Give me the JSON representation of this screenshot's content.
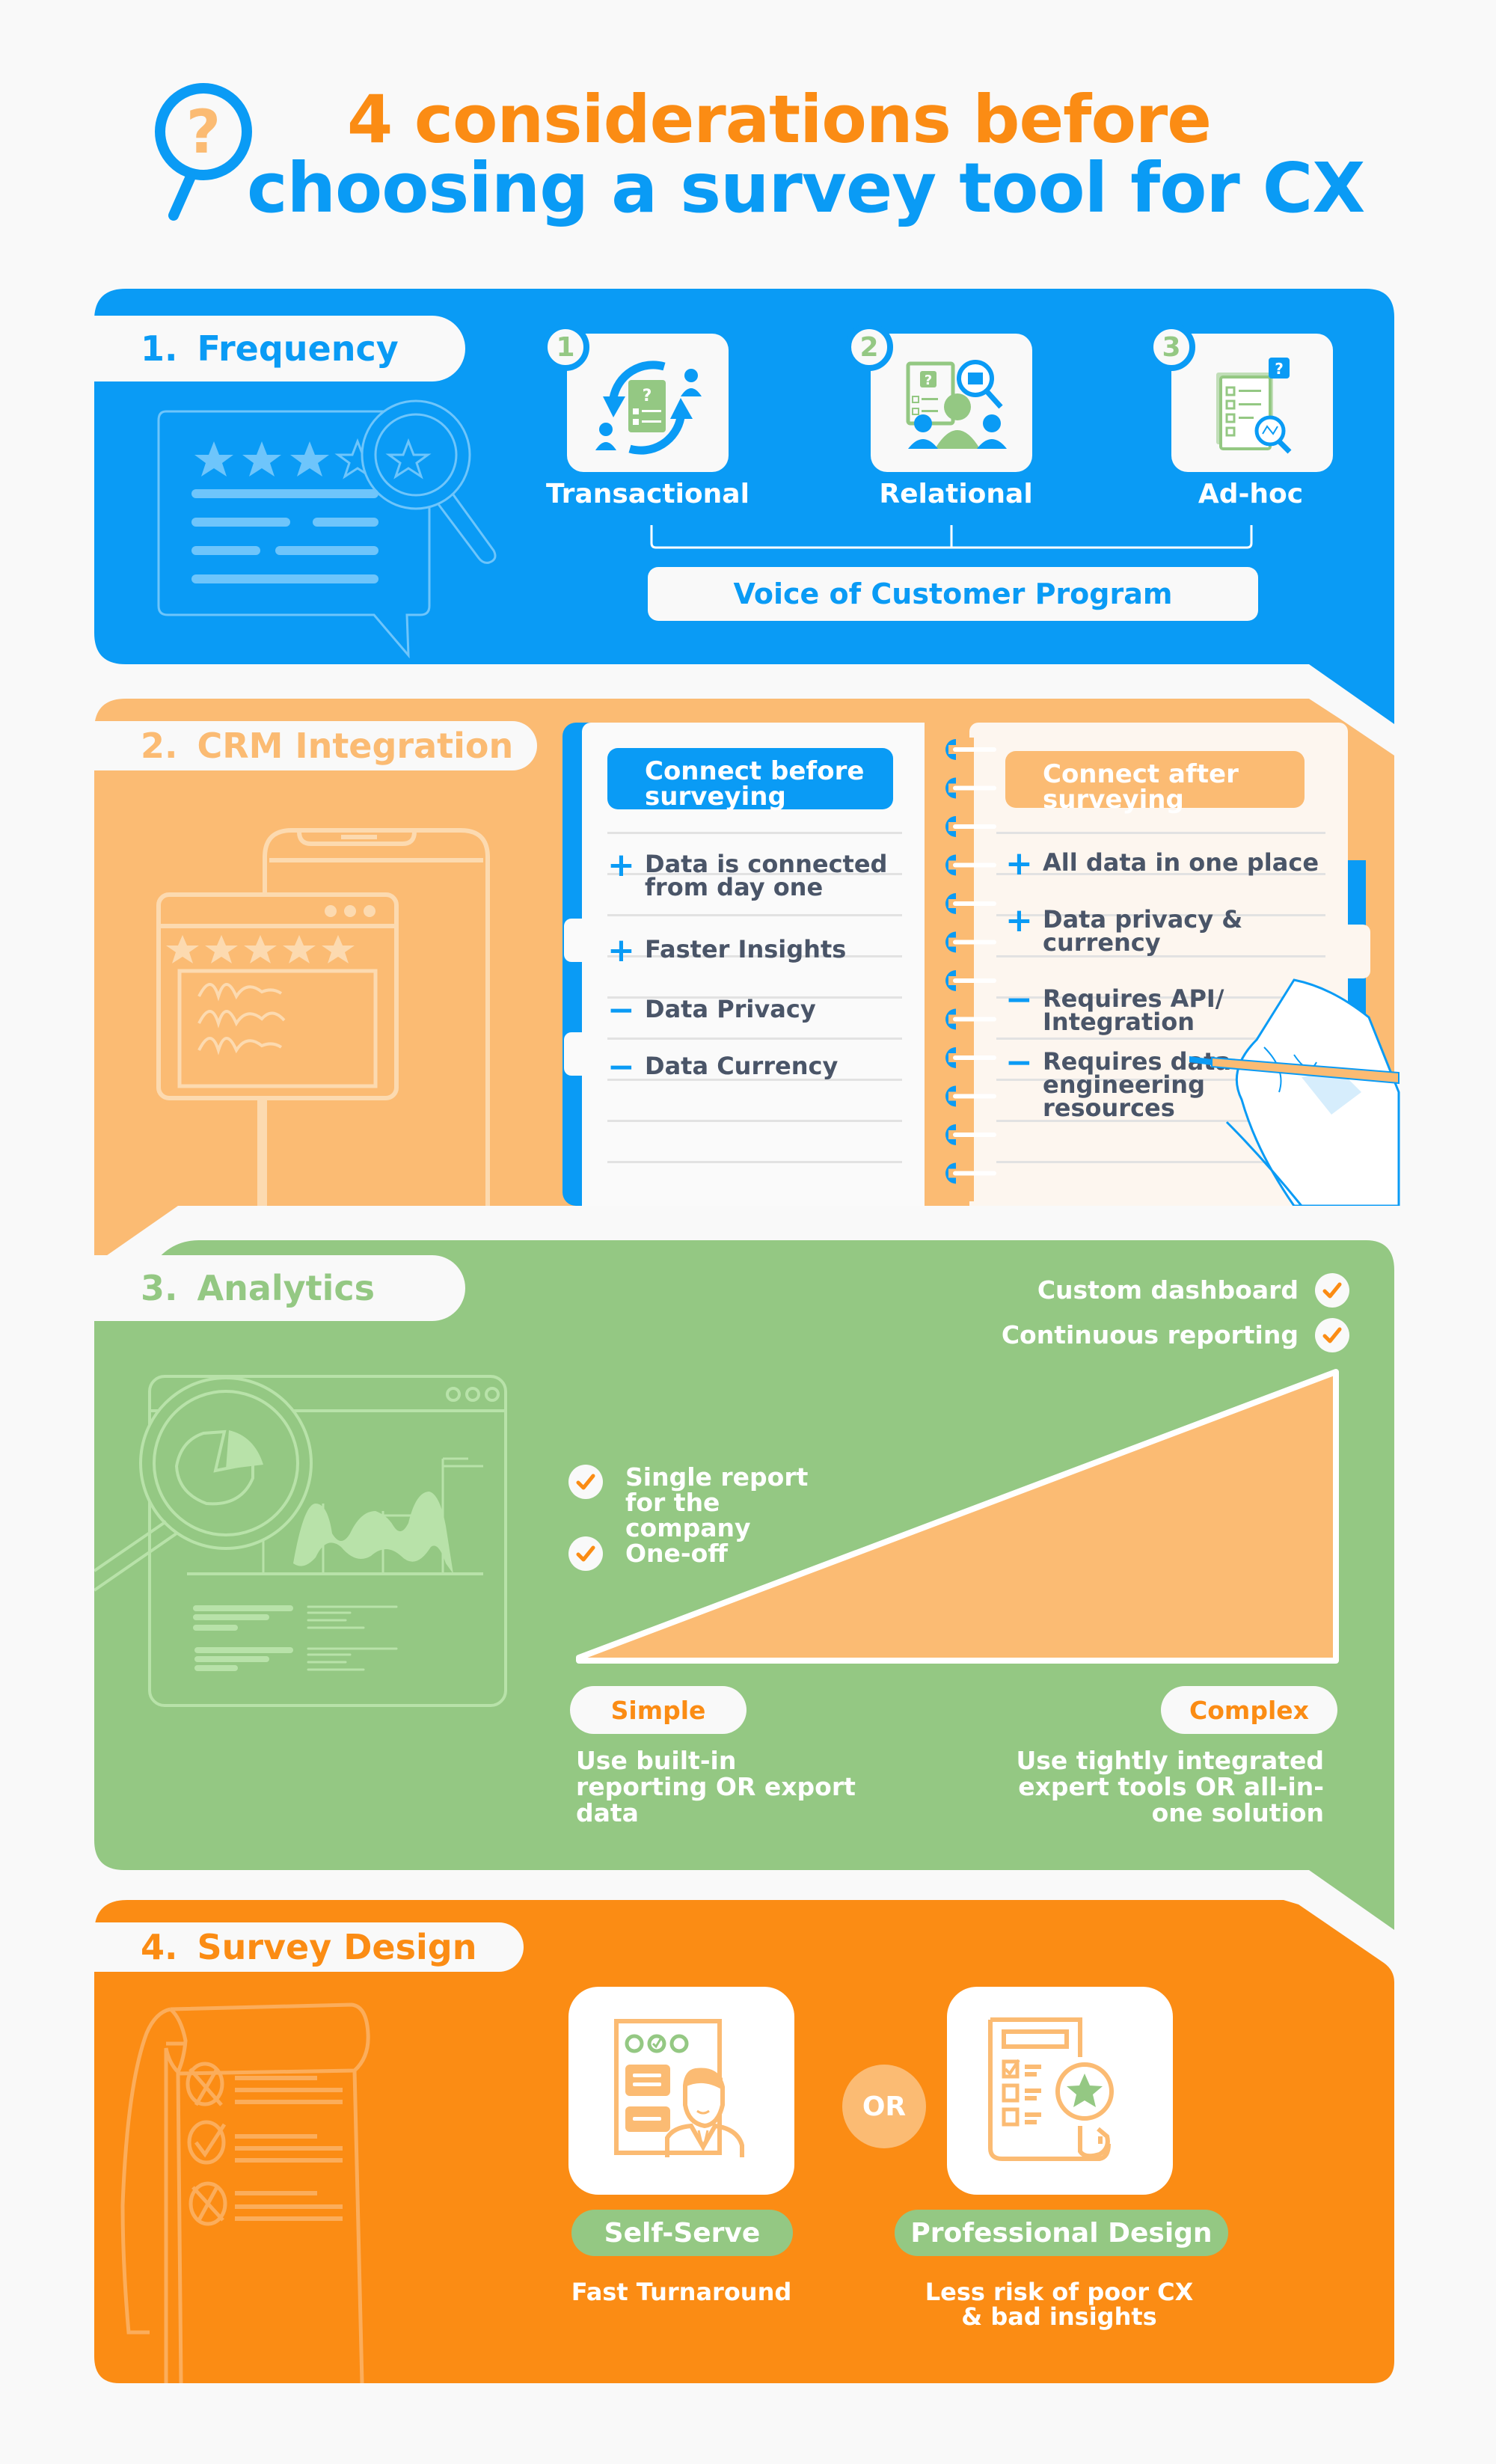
{
  "header": {
    "title_line1": "4 considerations before",
    "title_line2": "choosing a survey tool for CX",
    "icon": "magnifier-question-icon"
  },
  "colors": {
    "blue": "#0a9bf5",
    "orange": "#fb8c14",
    "light_orange": "#fbbb73",
    "green": "#94c883",
    "text_dark": "#4a5568",
    "background": "#f9f9f9"
  },
  "sections": {
    "frequency": {
      "number": "1.",
      "title": "Frequency",
      "illustration": "review-stars-magnifier",
      "types": [
        {
          "number": "1",
          "label": "Transactional",
          "icon": "transactional-survey-icon"
        },
        {
          "number": "2",
          "label": "Relational",
          "icon": "relational-survey-icon"
        },
        {
          "number": "3",
          "label": "Ad-hoc",
          "icon": "adhoc-survey-icon"
        }
      ],
      "program_label": "Voice of Customer Program"
    },
    "crm": {
      "number": "2.",
      "title": "CRM Integration",
      "illustration": "phone-rating-window",
      "before": {
        "heading": "Connect before surveying",
        "items": [
          {
            "sign": "+",
            "text": "Data is connected from day one"
          },
          {
            "sign": "+",
            "text": "Faster Insights"
          },
          {
            "sign": "−",
            "text": "Data Privacy"
          },
          {
            "sign": "−",
            "text": "Data Currency"
          }
        ]
      },
      "after": {
        "heading": "Connect after surveying",
        "items": [
          {
            "sign": "+",
            "text": "All data in one place"
          },
          {
            "sign": "+",
            "text": "Data privacy & currency"
          },
          {
            "sign": "−",
            "text": "Requires API/ Integration"
          },
          {
            "sign": "−",
            "text": "Requires data engineering resources"
          }
        ]
      }
    },
    "analytics": {
      "number": "3.",
      "title": "Analytics",
      "illustration": "dashboard-magnifier",
      "complex_features": [
        "Custom dashboard",
        "Continuous reporting"
      ],
      "simple_features": [
        "Single report for the company",
        "One-off"
      ],
      "simple": {
        "label": "Simple",
        "description": "Use built-in reporting OR export data"
      },
      "complex": {
        "label": "Complex",
        "description": "Use tightly integrated expert tools OR all-in-one solution"
      }
    },
    "design": {
      "number": "4.",
      "title": "Survey Design",
      "illustration": "checklist-scroll",
      "or_label": "OR",
      "options": [
        {
          "label": "Self-Serve",
          "description": "Fast Turnaround",
          "icon": "self-serve-icon"
        },
        {
          "label": "Professional Design",
          "description": "Less risk of poor CX & bad insights",
          "icon": "professional-design-icon"
        }
      ]
    }
  }
}
